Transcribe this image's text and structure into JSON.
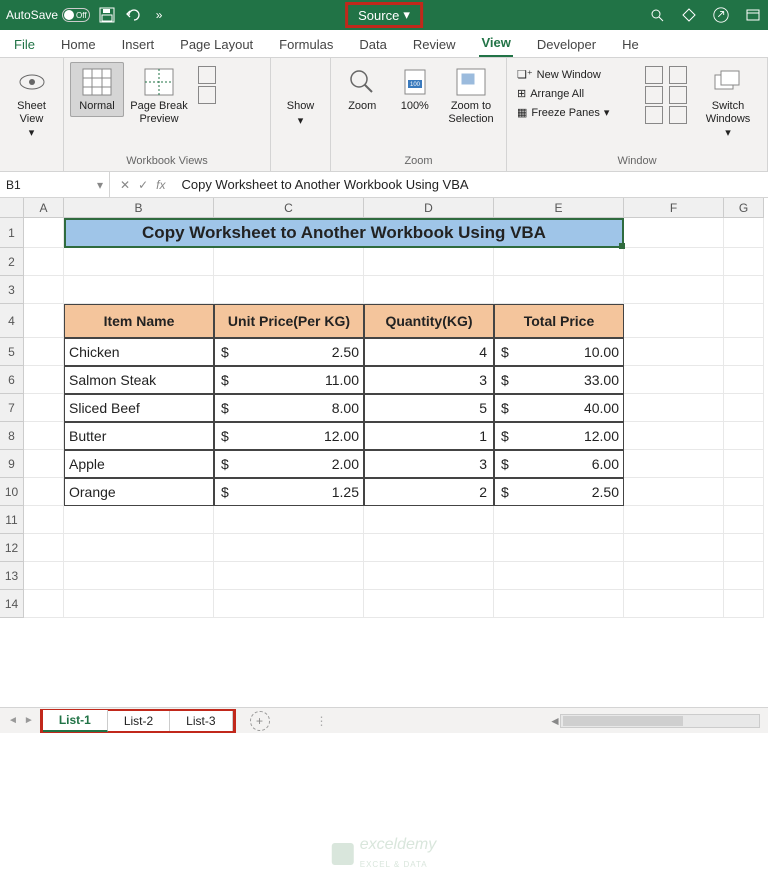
{
  "titlebar": {
    "autosave_label": "AutoSave",
    "autosave_state": "Off",
    "workbook_name": "Source"
  },
  "ribbon_tabs": [
    "File",
    "Home",
    "Insert",
    "Page Layout",
    "Formulas",
    "Data",
    "Review",
    "View",
    "Developer",
    "He"
  ],
  "active_tab": "View",
  "ribbon": {
    "sheet_view": "Sheet View",
    "normal": "Normal",
    "page_break": "Page Break Preview",
    "show": "Show",
    "zoom": "Zoom",
    "zoom100": "100%",
    "zoom_sel": "Zoom to Selection",
    "new_window": "New Window",
    "arrange_all": "Arrange All",
    "freeze_panes": "Freeze Panes",
    "switch_windows": "Switch Windows",
    "grp_views": "Workbook Views",
    "grp_zoom": "Zoom",
    "grp_window": "Window"
  },
  "formula_bar": {
    "name_box": "B1",
    "fx": "fx",
    "value": "Copy Worksheet to Another Workbook Using VBA"
  },
  "columns": [
    "A",
    "B",
    "C",
    "D",
    "E",
    "F",
    "G"
  ],
  "title_text": "Copy Worksheet to Another Workbook Using VBA",
  "table": {
    "headers": [
      "Item Name",
      "Unit Price(Per KG)",
      "Quantity(KG)",
      "Total Price"
    ],
    "rows": [
      {
        "item": "Chicken",
        "unit": "2.50",
        "qty": "4",
        "total": "10.00"
      },
      {
        "item": "Salmon Steak",
        "unit": "11.00",
        "qty": "3",
        "total": "33.00"
      },
      {
        "item": "Sliced Beef",
        "unit": "8.00",
        "qty": "5",
        "total": "40.00"
      },
      {
        "item": "Butter",
        "unit": "12.00",
        "qty": "1",
        "total": "12.00"
      },
      {
        "item": "Apple",
        "unit": "2.00",
        "qty": "3",
        "total": "6.00"
      },
      {
        "item": "Orange",
        "unit": "1.25",
        "qty": "2",
        "total": "2.50"
      }
    ]
  },
  "sheet_tabs": [
    "List-1",
    "List-2",
    "List-3"
  ],
  "active_sheet": "List-1",
  "watermark": {
    "brand": "exceldemy",
    "tag": "EXCEL & DATA"
  }
}
